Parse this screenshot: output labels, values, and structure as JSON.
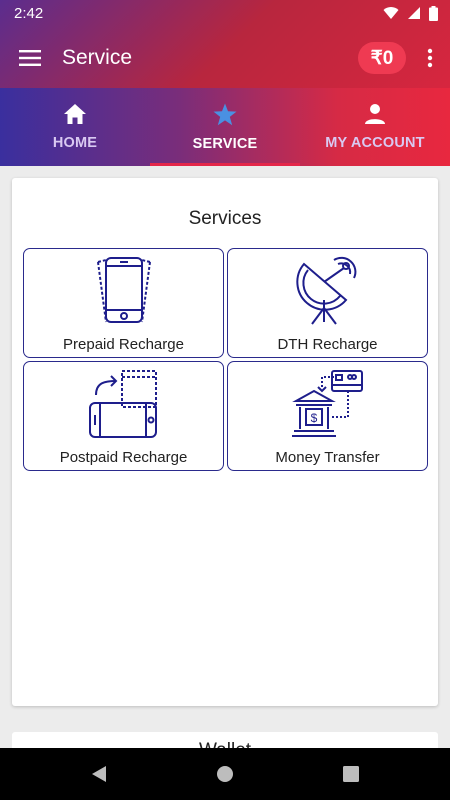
{
  "status_bar": {
    "time": "2:42"
  },
  "app_bar": {
    "title": "Service",
    "balance": "₹0"
  },
  "tabs": [
    {
      "label": "HOME",
      "icon": "home-icon",
      "active": false
    },
    {
      "label": "SERVICE",
      "icon": "star-icon",
      "active": true
    },
    {
      "label": "MY ACCOUNT",
      "icon": "person-icon",
      "active": false
    }
  ],
  "services": {
    "title": "Services",
    "items": [
      {
        "label": "Prepaid Recharge",
        "icon": "mobile-phone-icon"
      },
      {
        "label": "DTH Recharge",
        "icon": "satellite-dish-icon"
      },
      {
        "label": "Postpaid Recharge",
        "icon": "phone-rotate-icon"
      },
      {
        "label": "Money Transfer",
        "icon": "bank-transfer-icon"
      }
    ]
  },
  "wallet": {
    "title": "Wallet"
  },
  "colors": {
    "primary": "#e0263f",
    "accent": "#3a2f9e",
    "active_tab_icon": "#4a90e2",
    "icon_stroke": "#1e1e8c"
  }
}
